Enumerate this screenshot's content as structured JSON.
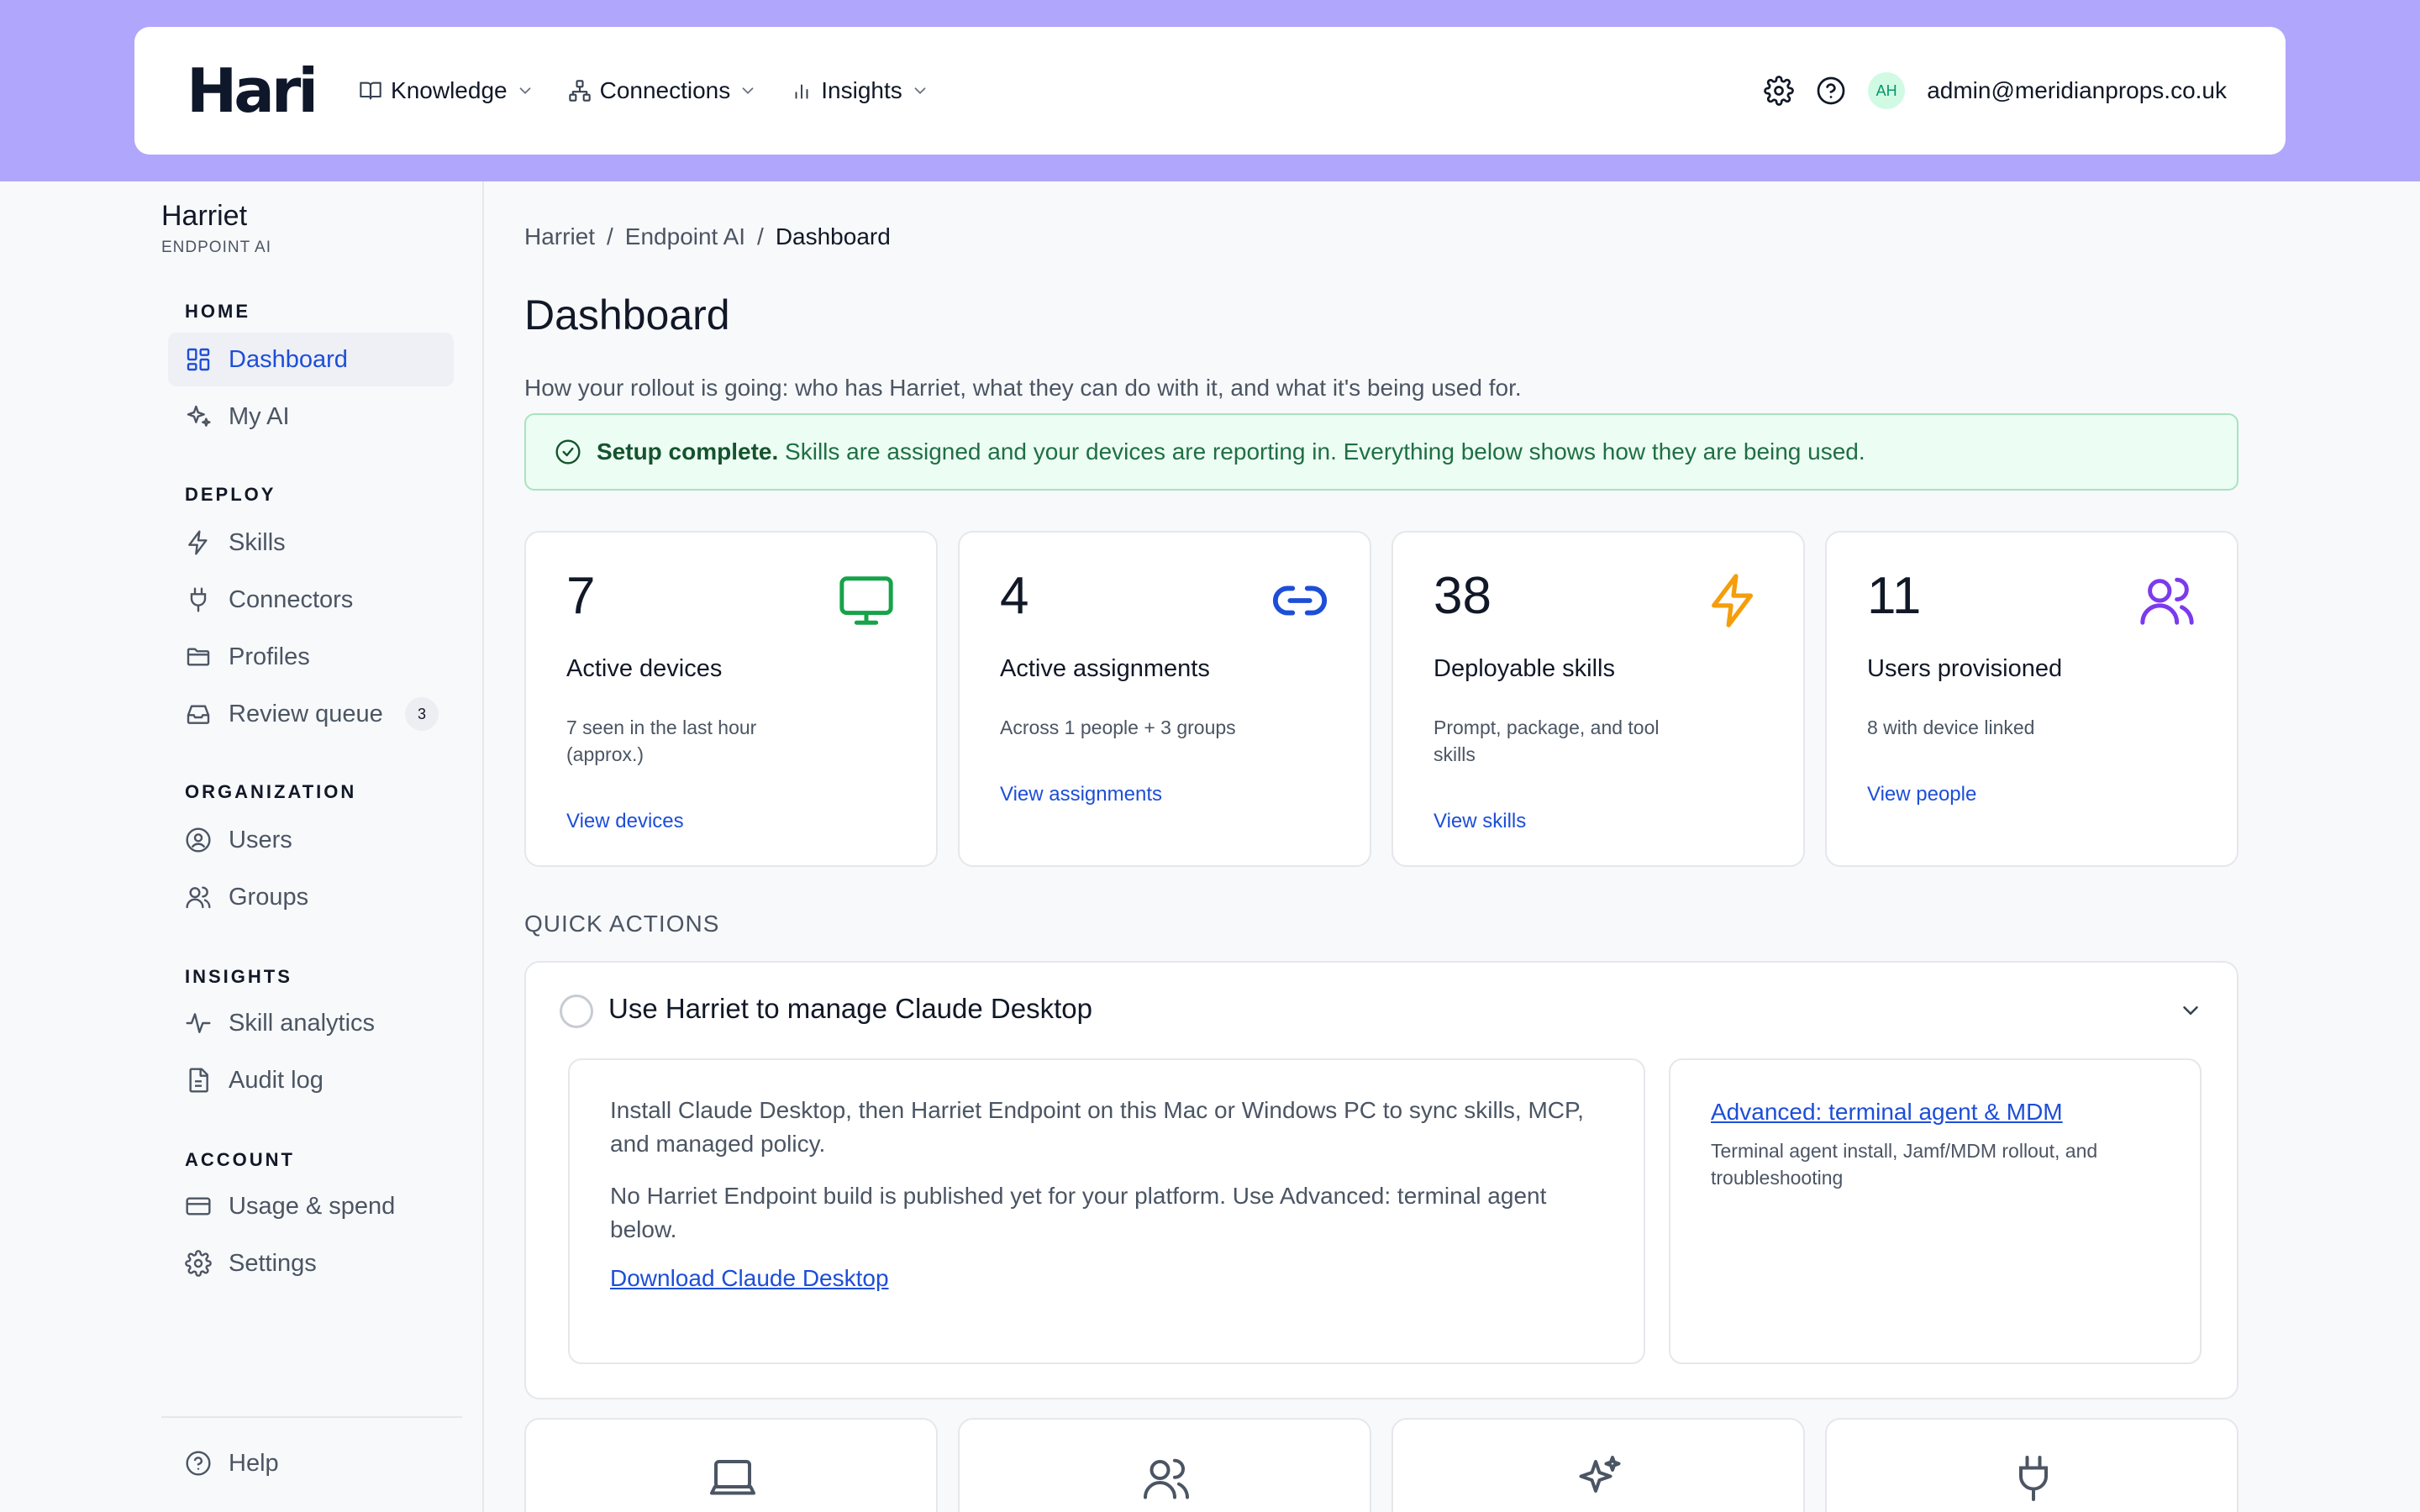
{
  "colors": {
    "top_band": "#b0a6fc",
    "link": "#1d4ed8",
    "active_nav": "#1d4ed8",
    "success_bg": "#ecfdf3",
    "success_border": "#a7e3c0",
    "devices_icon": "#16a34a",
    "assignments_icon": "#1d4ed8",
    "skills_icon": "#f59e0b",
    "users_icon": "#7c3aed"
  },
  "header": {
    "logo": "Hari",
    "nav": [
      {
        "label": "Knowledge",
        "icon": "book-icon"
      },
      {
        "label": "Connections",
        "icon": "network-icon"
      },
      {
        "label": "Insights",
        "icon": "bar-chart-icon"
      }
    ],
    "avatar_initials": "AH",
    "user_email": "admin@meridianprops.co.uk"
  },
  "sidebar": {
    "org_name": "Harriet",
    "org_subtitle": "ENDPOINT AI",
    "sections": {
      "home": "HOME",
      "deploy": "DEPLOY",
      "organization": "ORGANIZATION",
      "insights": "INSIGHTS",
      "account": "ACCOUNT"
    },
    "items": {
      "dashboard": "Dashboard",
      "my_ai": "My AI",
      "skills": "Skills",
      "connectors": "Connectors",
      "profiles": "Profiles",
      "review_queue": "Review queue",
      "review_queue_count": "3",
      "users": "Users",
      "groups": "Groups",
      "skill_analytics": "Skill analytics",
      "audit_log": "Audit log",
      "usage_spend": "Usage & spend",
      "settings": "Settings",
      "help": "Help"
    },
    "active_item": "Dashboard"
  },
  "breadcrumb": [
    "Harriet",
    "Endpoint AI",
    "Dashboard"
  ],
  "breadcrumb_sep": "/",
  "page": {
    "title": "Dashboard",
    "description": "How your rollout is going: who has Harriet, what they can do with it, and what it's being used for."
  },
  "banner": {
    "bold": "Setup complete.",
    "text": "Skills are assigned and your devices are reporting in. Everything below shows how they are being used."
  },
  "stats": [
    {
      "value": "7",
      "label": "Active devices",
      "sub": "7 seen in the last hour (approx.)",
      "link": "View devices",
      "icon": "monitor-icon"
    },
    {
      "value": "4",
      "label": "Active assignments",
      "sub": "Across 1 people + 3 groups",
      "link": "View assignments",
      "icon": "link-icon"
    },
    {
      "value": "38",
      "label": "Deployable skills",
      "sub": "Prompt, package, and tool skills",
      "link": "View skills",
      "icon": "lightning-icon"
    },
    {
      "value": "11",
      "label": "Users provisioned",
      "sub": "8 with device linked",
      "link": "View people",
      "icon": "users-icon"
    }
  ],
  "quick_actions": {
    "heading": "QUICK ACTIONS",
    "title": "Use Harriet to manage Claude Desktop",
    "para1": "Install Claude Desktop, then Harriet Endpoint on this Mac or Windows PC to sync skills, MCP, and managed policy.",
    "para2": "No Harriet Endpoint build is published yet for your platform. Use Advanced: terminal agent below.",
    "download_link": "Download Claude Desktop",
    "advanced_link": "Advanced: terminal agent & MDM",
    "advanced_desc": "Terminal agent install, Jamf/MDM rollout, and troubleshooting"
  },
  "bottom_cards": [
    "laptop-icon",
    "users-icon",
    "sparkles-icon",
    "plug-icon"
  ]
}
